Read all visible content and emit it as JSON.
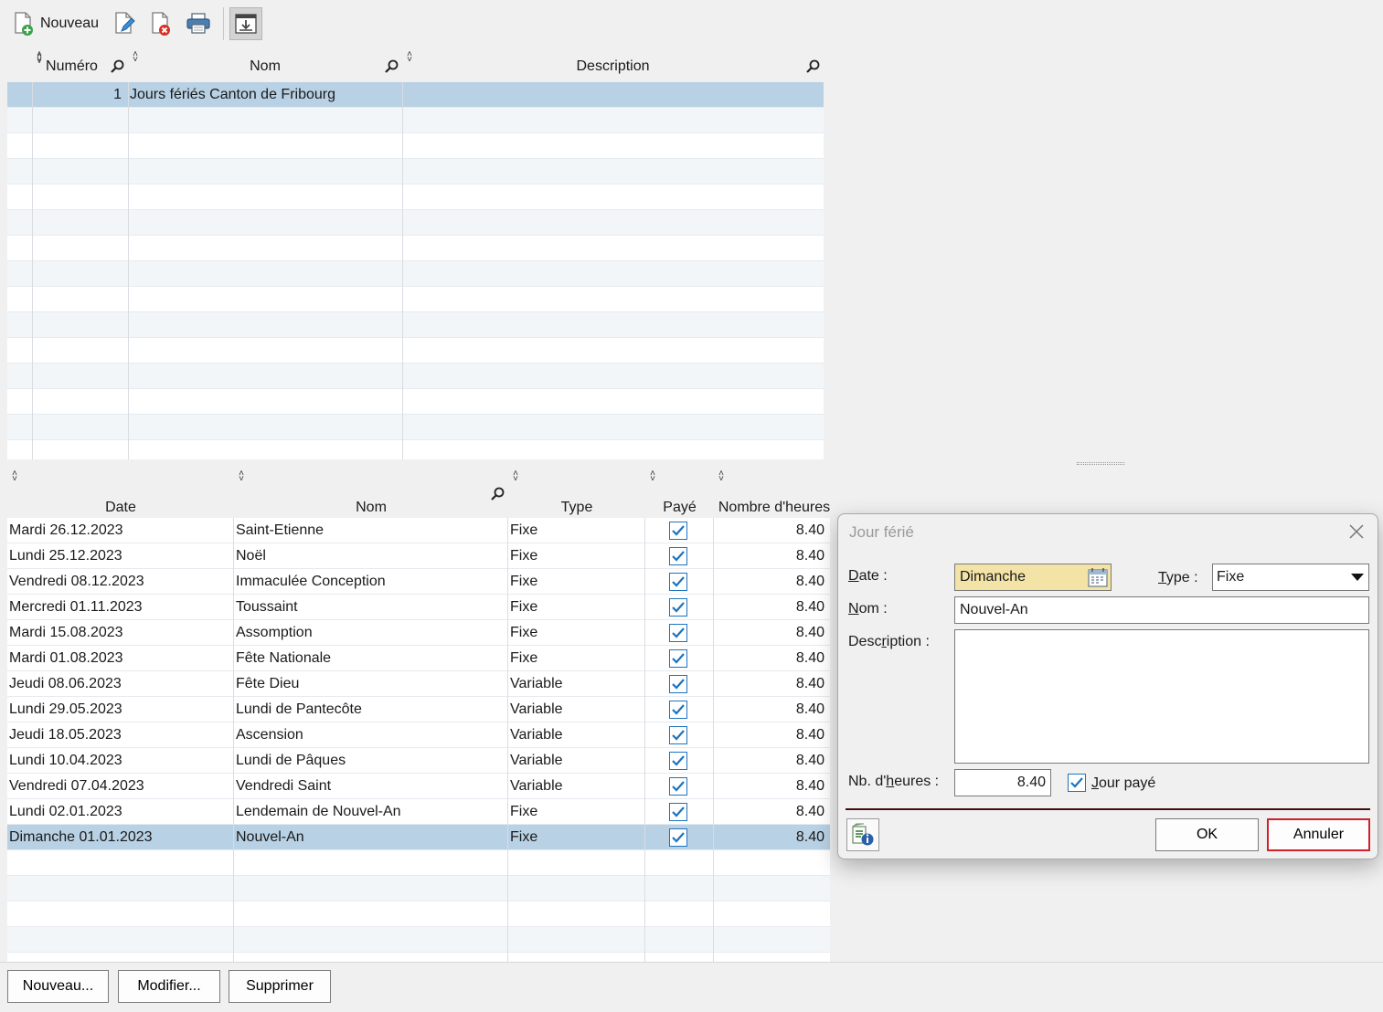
{
  "toolbar": {
    "new_label": "Nouveau"
  },
  "plans_grid": {
    "columns": [
      "Numéro",
      "Nom",
      "Description"
    ],
    "rows": [
      {
        "numero": "1",
        "nom": "Jours fériés Canton de Fribourg",
        "description": ""
      }
    ]
  },
  "holidays_grid": {
    "columns": [
      "Date",
      "Nom",
      "Type",
      "Payé",
      "Nombre d'heures"
    ],
    "rows": [
      {
        "date": "Mardi 26.12.2023",
        "nom": "Saint-Etienne",
        "type": "Fixe",
        "paye": true,
        "heures": "8.40"
      },
      {
        "date": "Lundi 25.12.2023",
        "nom": "Noël",
        "type": "Fixe",
        "paye": true,
        "heures": "8.40"
      },
      {
        "date": "Vendredi 08.12.2023",
        "nom": "Immaculée Conception",
        "type": "Fixe",
        "paye": true,
        "heures": "8.40"
      },
      {
        "date": "Mercredi 01.11.2023",
        "nom": "Toussaint",
        "type": "Fixe",
        "paye": true,
        "heures": "8.40"
      },
      {
        "date": "Mardi 15.08.2023",
        "nom": "Assomption",
        "type": "Fixe",
        "paye": true,
        "heures": "8.40"
      },
      {
        "date": "Mardi 01.08.2023",
        "nom": "Fête Nationale",
        "type": "Fixe",
        "paye": true,
        "heures": "8.40"
      },
      {
        "date": "Jeudi 08.06.2023",
        "nom": "Fête Dieu",
        "type": "Variable",
        "paye": true,
        "heures": "8.40"
      },
      {
        "date": "Lundi 29.05.2023",
        "nom": "Lundi de Pantecôte",
        "type": "Variable",
        "paye": true,
        "heures": "8.40"
      },
      {
        "date": "Jeudi 18.05.2023",
        "nom": "Ascension",
        "type": "Variable",
        "paye": true,
        "heures": "8.40"
      },
      {
        "date": "Lundi 10.04.2023",
        "nom": "Lundi de Pâques",
        "type": "Variable",
        "paye": true,
        "heures": "8.40"
      },
      {
        "date": "Vendredi 07.04.2023",
        "nom": "Vendredi Saint",
        "type": "Variable",
        "paye": true,
        "heures": "8.40"
      },
      {
        "date": "Lundi 02.01.2023",
        "nom": "Lendemain de Nouvel-An",
        "type": "Fixe",
        "paye": true,
        "heures": "8.40"
      },
      {
        "date": "Dimanche 01.01.2023",
        "nom": "Nouvel-An",
        "type": "Fixe",
        "paye": true,
        "heures": "8.40"
      }
    ],
    "selected_index": 12
  },
  "bottom_buttons": {
    "new": "Nouveau...",
    "edit": "Modifier...",
    "delete": "Supprimer"
  },
  "dialog": {
    "title": "Jour férié",
    "date_label_underlined": "D",
    "date_label_rest": "ate :",
    "date_value": "Dimanche",
    "type_label_underlined": "T",
    "type_label_rest": "ype :",
    "type_value": "Fixe",
    "name_label_underlined": "N",
    "name_label_rest": "om :",
    "name_value": "Nouvel-An",
    "desc_label_start": "Desc",
    "desc_label_underlined": "r",
    "desc_label_rest": "iption :",
    "desc_value": "",
    "hours_label_start": "Nb. d'",
    "hours_label_underlined": "h",
    "hours_label_rest": "eures :",
    "hours_value": "8.40",
    "paid_label_underlined": "J",
    "paid_label_rest": "our payé",
    "paid_checked": true,
    "ok": "OK",
    "cancel": "Annuler"
  },
  "colors": {
    "selection": "#b8d1e4",
    "checkbox": "#1e73be",
    "date_field_bg": "#f3e3a6",
    "cancel_border": "#d0202a"
  }
}
